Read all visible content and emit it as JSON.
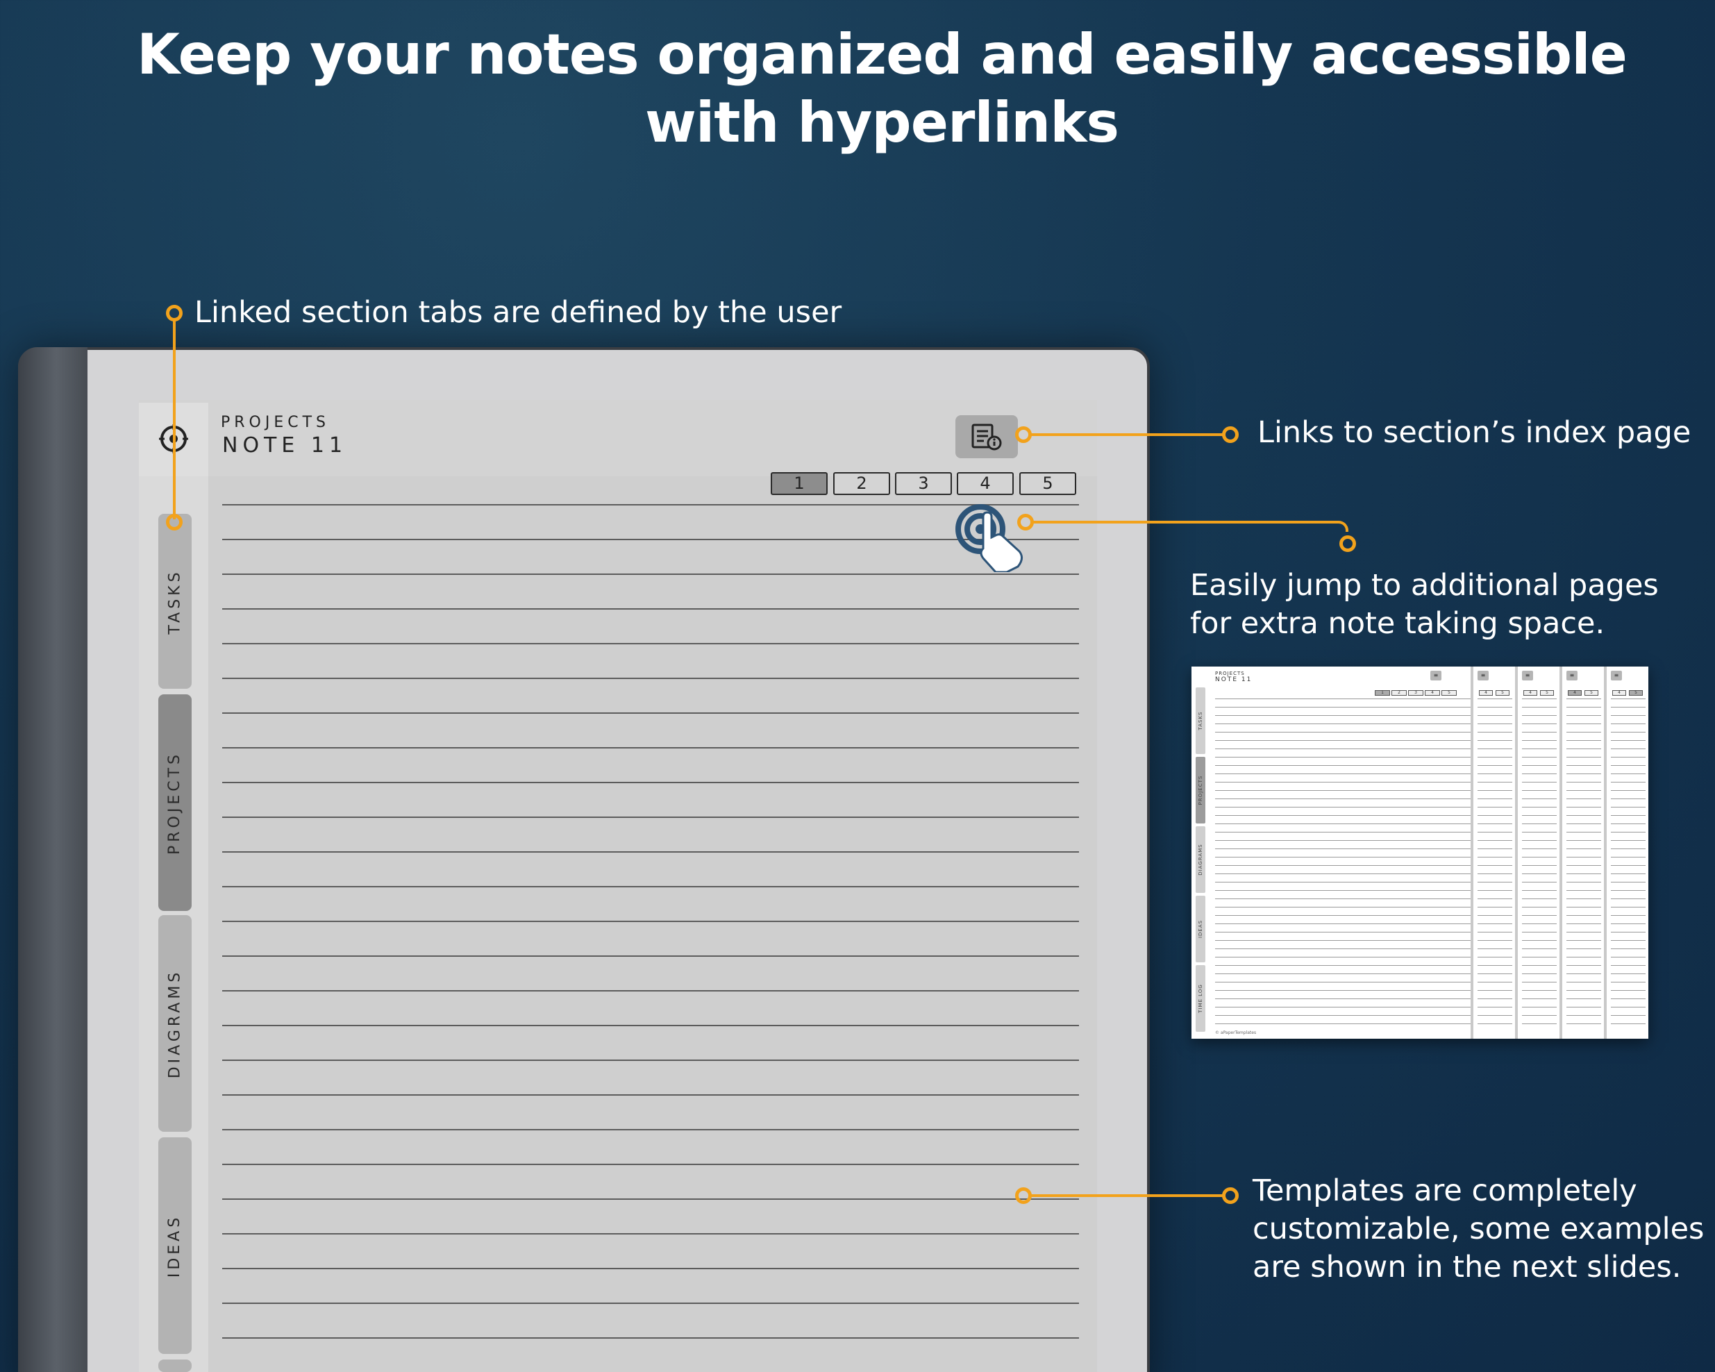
{
  "headline": {
    "line1": "Keep your notes organized and easily accessible",
    "line2": "with hyperlinks"
  },
  "callouts": {
    "tabs": "Linked section tabs are defined by the user",
    "index": "Links to section’s index page",
    "pages_line1": "Easily jump to additional pages",
    "pages_line2": "for extra note taking space.",
    "templates_line1": "Templates are completely",
    "templates_line2": "customizable, some examples",
    "templates_line3": "are shown in the next slides."
  },
  "accent_color": "#f2a21c",
  "notebook": {
    "kicker": "PROJECTS",
    "title": "NOTE 11",
    "header_icon": "target-icon",
    "index_icon": "index-page-icon",
    "tap_icon": "tap-hand-icon",
    "pages": [
      "1",
      "2",
      "3",
      "4",
      "5"
    ],
    "active_page": "1",
    "tabs": [
      {
        "label": "TASKS",
        "active": false
      },
      {
        "label": "PROJECTS",
        "active": true
      },
      {
        "label": "DIAGRAMS",
        "active": false
      },
      {
        "label": "IDEAS",
        "active": false
      }
    ]
  },
  "preview": {
    "kicker": "PROJECTS",
    "title": "NOTE 11",
    "pages": [
      "1",
      "2",
      "3",
      "4",
      "5"
    ],
    "extra_page_buttons": [
      "4",
      "5"
    ],
    "tabs": [
      "TASKS",
      "PROJECTS",
      "DIAGRAMS",
      "IDEAS",
      "TIME LOG"
    ],
    "footer": "© aPaperTemplates"
  }
}
